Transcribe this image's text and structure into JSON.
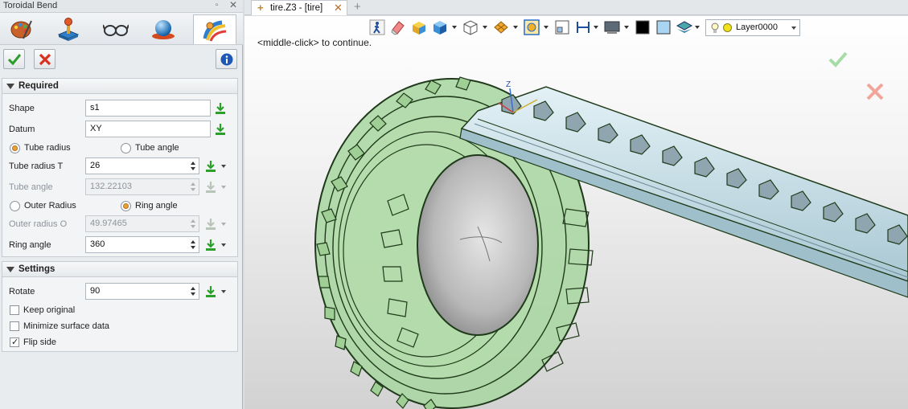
{
  "panel": {
    "title": "Toroidal Bend",
    "icon_tabs": [
      "palette-icon",
      "joystick-icon",
      "glasses-icon",
      "sphere-icon",
      "toroidal-bend-icon"
    ],
    "ok_icon": "green-check-icon",
    "cancel_icon": "red-x-icon",
    "info_icon": "info-icon"
  },
  "required": {
    "header": "Required",
    "shape_label": "Shape",
    "shape_value": "s1",
    "datum_label": "Datum",
    "datum_value": "XY",
    "radio_tube_radius": "Tube radius",
    "radio_tube_angle": "Tube angle",
    "tube_radius_label": "Tube radius T",
    "tube_radius_value": "26",
    "tube_angle_label": "Tube angle",
    "tube_angle_value": "132.22103",
    "radio_outer_radius": "Outer Radius",
    "radio_ring_angle": "Ring angle",
    "outer_radius_label": "Outer radius O",
    "outer_radius_value": "49.97465",
    "ring_angle_label": "Ring angle",
    "ring_angle_value": "360"
  },
  "settings": {
    "header": "Settings",
    "rotate_label": "Rotate",
    "rotate_value": "90",
    "keep_original": "Keep original",
    "minimize_surface": "Minimize surface data",
    "flip_side": "Flip side",
    "keep_original_checked": false,
    "minimize_surface_checked": false,
    "flip_side_checked": true
  },
  "document": {
    "tab_name": "tire.Z3 - [tire]",
    "hint": "<middle-click> to continue.",
    "layer_name": "Layer0000",
    "axis_label": "Z"
  },
  "colors": {
    "tire_green": "#a8d6a0",
    "tire_edge": "#1f3a1a",
    "tread_strip": "#cde3ea",
    "tread_block": "#8fa6b0",
    "accept_green": "#3aa43a",
    "cancel_red": "#d63a2a",
    "radio_orange": "#e8a13a"
  }
}
